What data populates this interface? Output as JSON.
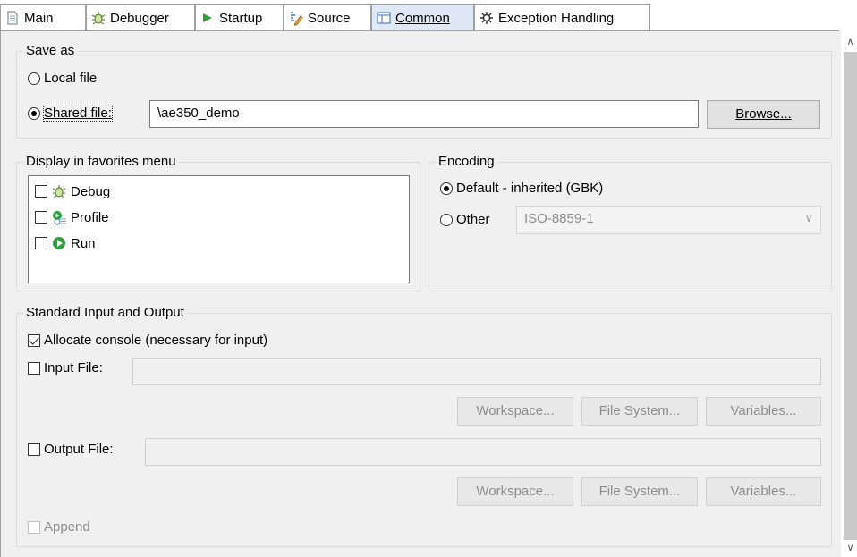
{
  "tabs": [
    {
      "label": "Main",
      "icon": "document-icon",
      "active": false
    },
    {
      "label": "Debugger",
      "icon": "bug-icon",
      "active": false
    },
    {
      "label": "Startup",
      "icon": "play-arrow-icon",
      "active": false
    },
    {
      "label": "Source",
      "icon": "source-icon",
      "active": false
    },
    {
      "label": "Common",
      "icon": "common-icon",
      "active": true
    },
    {
      "label": "Exception Handling",
      "icon": "gear-icon",
      "active": false
    }
  ],
  "save_as": {
    "title": "Save as",
    "local_label": "Local file",
    "shared_label": "Shared file:",
    "shared_value": "\\ae350_demo",
    "browse_label": "Browse..."
  },
  "favorites": {
    "title": "Display in favorites menu",
    "items": [
      {
        "label": "Debug",
        "icon": "bug-icon",
        "checked": false
      },
      {
        "label": "Profile",
        "icon": "profile-icon",
        "checked": false
      },
      {
        "label": "Run",
        "icon": "run-icon",
        "checked": false
      }
    ]
  },
  "encoding": {
    "title": "Encoding",
    "default_label": "Default - inherited (GBK)",
    "other_label": "Other",
    "other_value": "ISO-8859-1"
  },
  "std_io": {
    "title": "Standard Input and Output",
    "allocate_label": "Allocate console (necessary for input)",
    "input_label": "Input File:",
    "output_label": "Output File:",
    "workspace_label": "Workspace...",
    "filesystem_label": "File System...",
    "variables_label": "Variables...",
    "append_label": "Append"
  },
  "colors": {
    "active_tab": "#dfe8f6",
    "panel_bg": "#f0f0f0",
    "run_green": "#2aa33a"
  }
}
